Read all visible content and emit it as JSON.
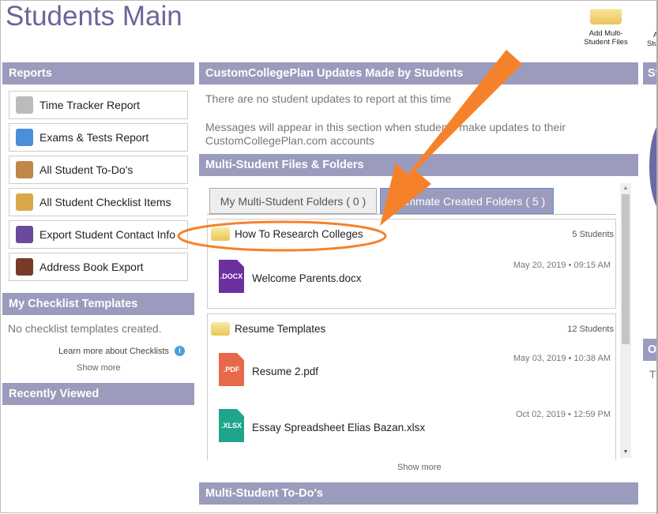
{
  "page": {
    "title": "Students Main"
  },
  "toolbar": {
    "add_files": "Add Multi-\nStudent Files",
    "add_second_partial_1": "A",
    "add_second_partial_2": "Stu"
  },
  "reports": {
    "header": "Reports",
    "items": [
      {
        "label": "Time Tracker Report",
        "icon": "stopwatch-icon",
        "color": "#bbbbbb"
      },
      {
        "label": "Exams & Tests Report",
        "icon": "bar-chart-icon",
        "color": "#4a90d9"
      },
      {
        "label": "All Student To-Do's",
        "icon": "clipboard-icon",
        "color": "#c0874a"
      },
      {
        "label": "All Student Checklist Items",
        "icon": "notepad-icon",
        "color": "#d8a84a"
      },
      {
        "label": "Export Student Contact Info",
        "icon": "people-icon",
        "color": "#6a4a9a"
      },
      {
        "label": "Address Book Export",
        "icon": "address-book-icon",
        "color": "#7a3a2a"
      }
    ]
  },
  "checklists": {
    "header": "My Checklist Templates",
    "empty": "No checklist templates created.",
    "learn_more": "Learn more about Checklists",
    "show_more": "Show more"
  },
  "recent": {
    "header": "Recently Viewed"
  },
  "updates": {
    "header": "CustomCollegePlan Updates Made by Students",
    "empty": "There are no student updates to report at this time",
    "info": "Messages will appear in this section when students make updates to their CustomCollegePlan.com accounts"
  },
  "files": {
    "header": "Multi-Student Files & Folders",
    "tabs": [
      {
        "label": "My Multi-Student Folders ( 0 )",
        "active": false
      },
      {
        "label": "Teammate Created Folders ( 5 )",
        "active": true
      }
    ],
    "folders": [
      {
        "name": "How To Research Colleges",
        "count": "5 Students",
        "files": [
          {
            "name": "Welcome Parents.docx",
            "ext": ".DOCX",
            "color": "#6b2fa0",
            "date": "May 20, 2019 • 09:15 AM"
          }
        ]
      },
      {
        "name": "Resume Templates",
        "count": "12 Students",
        "files": [
          {
            "name": "Resume 2.pdf",
            "ext": ".PDF",
            "color": "#e8684a",
            "date": "May 03, 2019 • 10:38 AM"
          },
          {
            "name": "Essay Spreadsheet Elias Bazan.xlsx",
            "ext": ".XLSX",
            "color": "#1fa58a",
            "date": "Oct 02, 2019 • 12:59 PM"
          }
        ]
      }
    ],
    "show_more": "Show more"
  },
  "todos": {
    "header": "Multi-Student To-Do's"
  },
  "right_partial": {
    "h1": "St",
    "h2": "O",
    "t": "Th"
  },
  "annotation": {
    "color": "#f5822a"
  }
}
